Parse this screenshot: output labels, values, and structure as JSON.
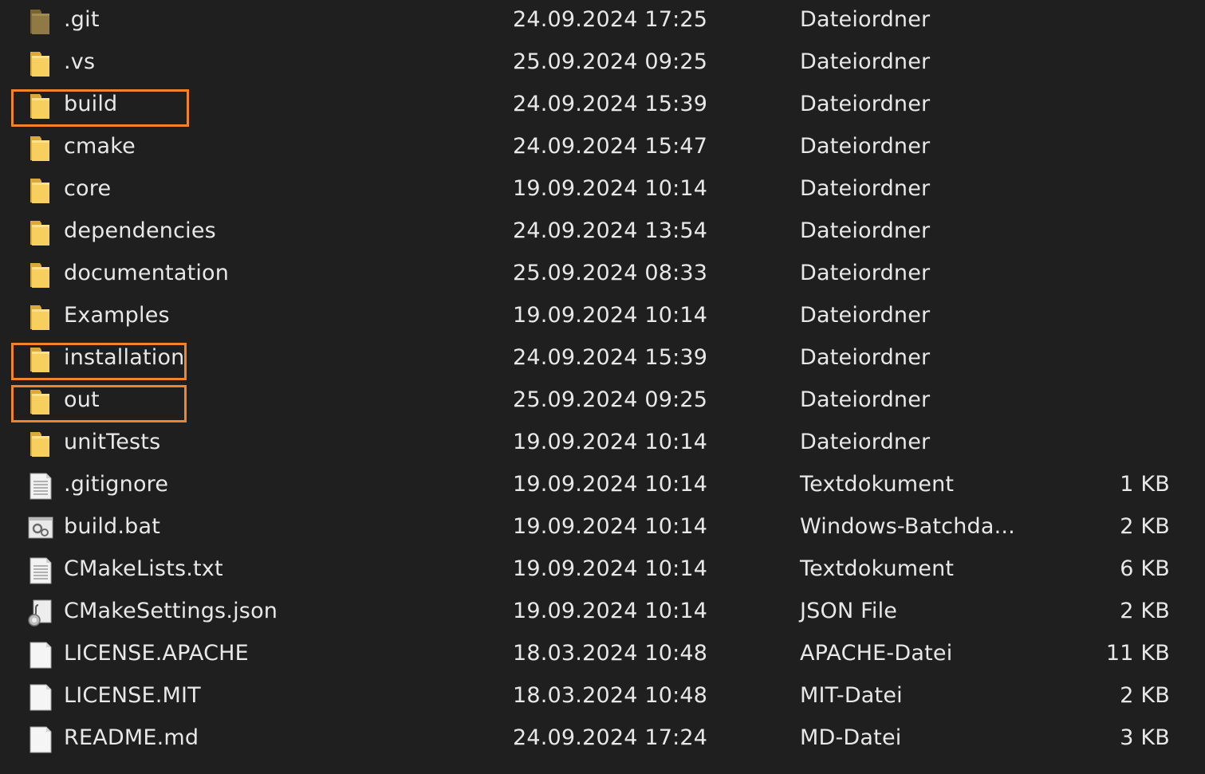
{
  "files": [
    {
      "name": ".git",
      "date": "24.09.2024 17:25",
      "type": "Dateiordner",
      "size": "",
      "icon": "folder-dim-icon"
    },
    {
      "name": ".vs",
      "date": "25.09.2024 09:25",
      "type": "Dateiordner",
      "size": "",
      "icon": "folder-icon"
    },
    {
      "name": "build",
      "date": "24.09.2024 15:39",
      "type": "Dateiordner",
      "size": "",
      "icon": "folder-icon",
      "highlighted": true
    },
    {
      "name": "cmake",
      "date": "24.09.2024 15:47",
      "type": "Dateiordner",
      "size": "",
      "icon": "folder-icon"
    },
    {
      "name": "core",
      "date": "19.09.2024 10:14",
      "type": "Dateiordner",
      "size": "",
      "icon": "folder-icon"
    },
    {
      "name": "dependencies",
      "date": "24.09.2024 13:54",
      "type": "Dateiordner",
      "size": "",
      "icon": "folder-icon"
    },
    {
      "name": "documentation",
      "date": "25.09.2024 08:33",
      "type": "Dateiordner",
      "size": "",
      "icon": "folder-icon"
    },
    {
      "name": "Examples",
      "date": "19.09.2024 10:14",
      "type": "Dateiordner",
      "size": "",
      "icon": "folder-icon"
    },
    {
      "name": "installation",
      "date": "24.09.2024 15:39",
      "type": "Dateiordner",
      "size": "",
      "icon": "folder-icon",
      "highlighted": true
    },
    {
      "name": "out",
      "date": "25.09.2024 09:25",
      "type": "Dateiordner",
      "size": "",
      "icon": "folder-icon",
      "highlighted": true
    },
    {
      "name": "unitTests",
      "date": "19.09.2024 10:14",
      "type": "Dateiordner",
      "size": "",
      "icon": "folder-icon"
    },
    {
      "name": ".gitignore",
      "date": "19.09.2024 10:14",
      "type": "Textdokument",
      "size": "1 KB",
      "icon": "text-document-icon"
    },
    {
      "name": "build.bat",
      "date": "19.09.2024 10:14",
      "type": "Windows-Batchda...",
      "size": "2 KB",
      "icon": "batch-file-icon"
    },
    {
      "name": "CMakeLists.txt",
      "date": "19.09.2024 10:14",
      "type": "Textdokument",
      "size": "6 KB",
      "icon": "text-document-icon"
    },
    {
      "name": "CMakeSettings.json",
      "date": "19.09.2024 10:14",
      "type": "JSON File",
      "size": "2 KB",
      "icon": "json-file-icon"
    },
    {
      "name": "LICENSE.APACHE",
      "date": "18.03.2024 10:48",
      "type": "APACHE-Datei",
      "size": "11 KB",
      "icon": "blank-file-icon"
    },
    {
      "name": "LICENSE.MIT",
      "date": "18.03.2024 10:48",
      "type": "MIT-Datei",
      "size": "2 KB",
      "icon": "blank-file-icon"
    },
    {
      "name": "README.md",
      "date": "24.09.2024 17:24",
      "type": "MD-Datei",
      "size": "3 KB",
      "icon": "blank-file-icon"
    }
  ],
  "colors": {
    "background": "#1f1f1f",
    "text": "#e8e8e8",
    "highlight": "#f0842c",
    "folder": "#f7cf5f"
  }
}
